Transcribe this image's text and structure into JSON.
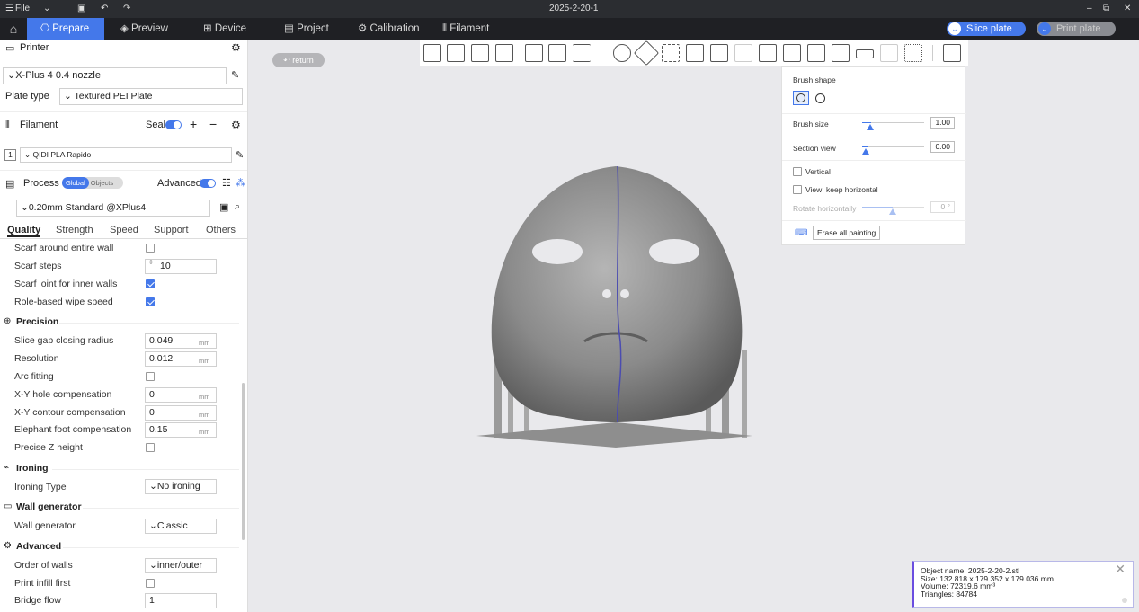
{
  "titlebar": {
    "menu_label": "File",
    "document_title": "2025-2-20-1"
  },
  "tabs": {
    "prepare": "Prepare",
    "preview": "Preview",
    "device": "Device",
    "project": "Project",
    "calibration": "Calibration",
    "filament": "Filament"
  },
  "actions": {
    "slice": "Slice plate",
    "print": "Print plate"
  },
  "printer": {
    "section_title": "Printer",
    "name": "X-Plus 4 0.4 nozzle",
    "plate_type_label": "Plate type",
    "plate_type_value": "Textured PEI Plate"
  },
  "filament": {
    "section_title": "Filament",
    "seal_label": "Seal",
    "slot_number": "1",
    "name": "QIDI PLA Rapido"
  },
  "process": {
    "section_title": "Process",
    "global_label": "Global",
    "objects_label": "Objects",
    "advanced_label": "Advanced",
    "preset": "0.20mm Standard @XPlus4"
  },
  "settings_tabs": [
    "Quality",
    "Strength",
    "Speed",
    "Support",
    "Others"
  ],
  "settings": {
    "scarf_entire_wall": "Scarf around entire wall",
    "scarf_steps": {
      "label": "Scarf steps",
      "value": "10"
    },
    "scarf_inner": "Scarf joint for inner walls",
    "role_wipe": "Role-based wipe speed",
    "precision_title": "Precision",
    "slice_gap": {
      "label": "Slice gap closing radius",
      "value": "0.049",
      "unit": "mm"
    },
    "resolution": {
      "label": "Resolution",
      "value": "0.012",
      "unit": "mm"
    },
    "arc_fitting": "Arc fitting",
    "xy_hole": {
      "label": "X-Y hole compensation",
      "value": "0",
      "unit": "mm"
    },
    "xy_contour": {
      "label": "X-Y contour compensation",
      "value": "0",
      "unit": "mm"
    },
    "elephant_foot": {
      "label": "Elephant foot compensation",
      "value": "0.15",
      "unit": "mm"
    },
    "precise_z": "Precise Z height",
    "ironing_title": "Ironing",
    "ironing_type": {
      "label": "Ironing Type",
      "value": "No ironing"
    },
    "wall_gen_title": "Wall generator",
    "wall_gen": {
      "label": "Wall generator",
      "value": "Classic"
    },
    "advanced_title": "Advanced",
    "order_walls": {
      "label": "Order of walls",
      "value": "inner/outer"
    },
    "print_infill_first": "Print infill first",
    "bridge_flow": {
      "label": "Bridge flow",
      "value": "1"
    }
  },
  "viewport": {
    "return_label": "return"
  },
  "paint_panel": {
    "brush_shape": "Brush shape",
    "brush_size": {
      "label": "Brush size",
      "value": "1.00"
    },
    "section_view": {
      "label": "Section view",
      "value": "0.00"
    },
    "vertical": "Vertical",
    "keep_horizontal": "View: keep horizontal",
    "rotate_horizontally": {
      "label": "Rotate horizontally",
      "value": "0 °"
    },
    "erase_all": "Erase all painting"
  },
  "object_info": {
    "name": "Object name: 2025-2-20-2.stl",
    "size": "Size: 132.818 x 179.352 x 179.036 mm",
    "volume": "Volume: 72319.6 mm³",
    "triangles": "Triangles: 84784"
  },
  "colors": {
    "accent": "#4478ea",
    "titlebar": "#2b2d31",
    "tabbar": "#1f2024",
    "info_border": "#6a4de0"
  }
}
